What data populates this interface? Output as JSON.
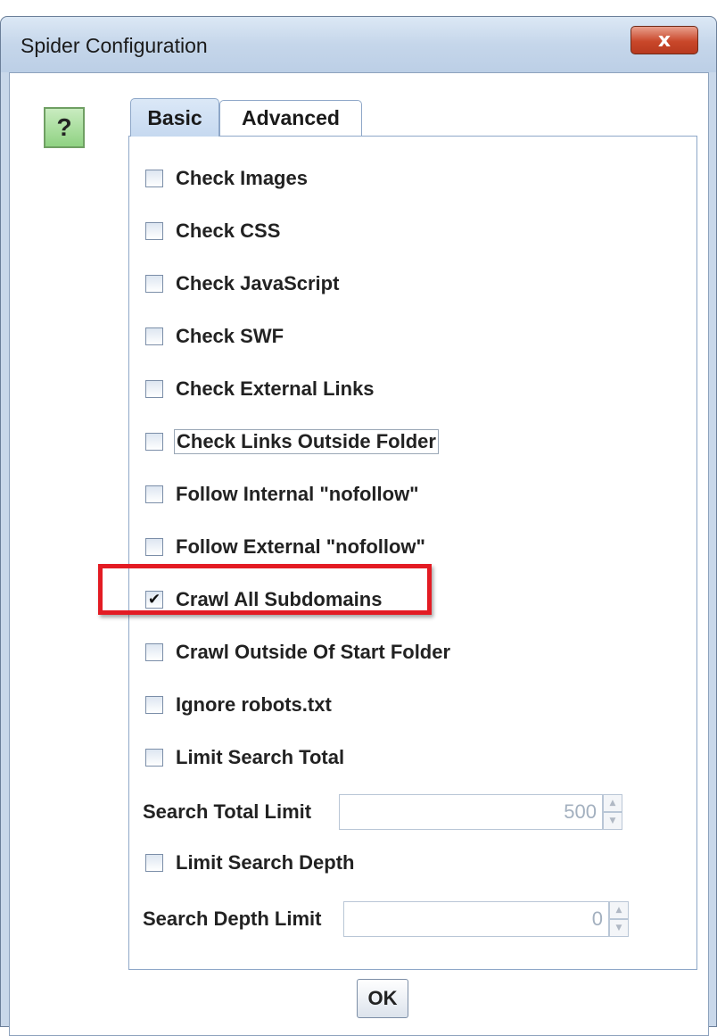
{
  "window": {
    "title": "Spider Configuration",
    "close_label": "x"
  },
  "help": {
    "label": "?"
  },
  "tabs": [
    {
      "label": "Basic",
      "selected": true
    },
    {
      "label": "Advanced",
      "selected": false
    }
  ],
  "options": [
    {
      "label": "Check Images",
      "checked": false
    },
    {
      "label": "Check CSS",
      "checked": false
    },
    {
      "label": "Check JavaScript",
      "checked": false
    },
    {
      "label": "Check SWF",
      "checked": false
    },
    {
      "label": "Check External Links",
      "checked": false
    },
    {
      "label": "Check Links Outside Folder",
      "checked": false
    },
    {
      "label": "Follow Internal \"nofollow\"",
      "checked": false
    },
    {
      "label": "Follow External \"nofollow\"",
      "checked": false
    },
    {
      "label": "Crawl All Subdomains",
      "checked": true
    },
    {
      "label": "Crawl Outside Of Start Folder",
      "checked": false
    },
    {
      "label": "Ignore robots.txt",
      "checked": false
    },
    {
      "label": "Limit Search Total",
      "checked": false
    },
    {
      "label": "Limit Search Depth",
      "checked": false
    }
  ],
  "search_total_limit": {
    "label": "Search Total Limit",
    "value": "500"
  },
  "search_depth_limit": {
    "label": "Search Depth Limit",
    "value": "0"
  },
  "ok_label": "OK",
  "check_mark": "✔",
  "spin_up": "▲",
  "spin_down": "▼"
}
